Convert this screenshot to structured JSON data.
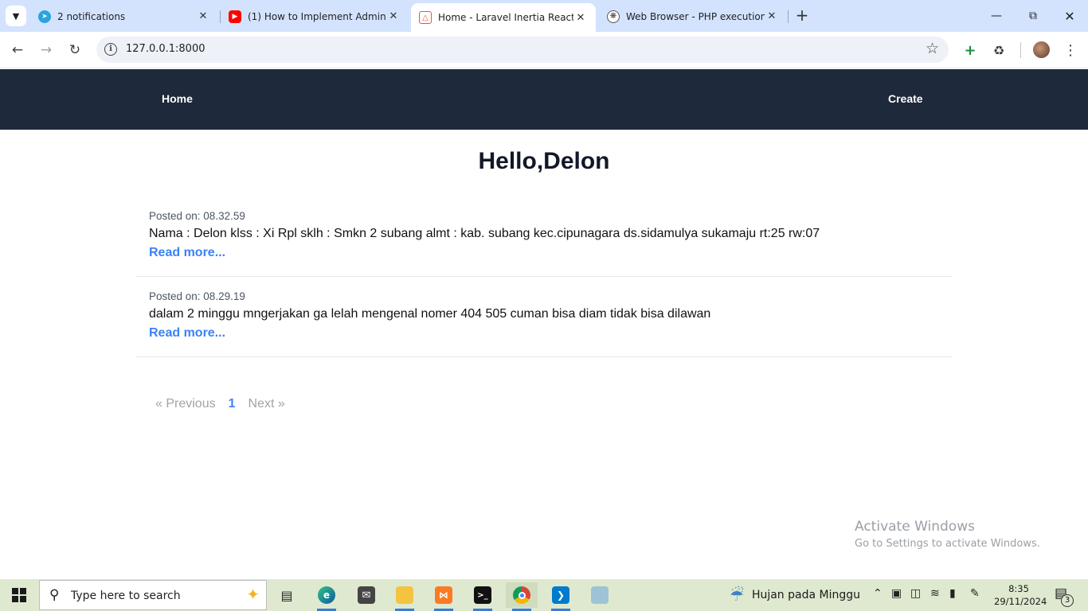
{
  "browser": {
    "tabs": [
      {
        "title": "2 notifications",
        "favicon": "telegram-icon"
      },
      {
        "title": "(1) How to Implement AdminLTE",
        "favicon": "youtube-icon"
      },
      {
        "title": "Home - Laravel Inertia React",
        "favicon": "laravel-icon",
        "active": true
      },
      {
        "title": "Web Browser - PHP execution t",
        "favicon": "openai-icon"
      }
    ],
    "new_tab": "+",
    "url": "127.0.0.1:8000"
  },
  "navbar": {
    "home": "Home",
    "create": "Create"
  },
  "page": {
    "greeting": "Hello,Delon",
    "posts": [
      {
        "posted_on": "Posted on: 08.32.59",
        "body": "Nama : Delon klss : Xi Rpl sklh : Smkn 2 subang almt : kab. subang kec.cipunagara ds.sidamulya sukamaju rt:25 rw:07",
        "read_more": "Read more..."
      },
      {
        "posted_on": "Posted on: 08.29.19",
        "body": "dalam 2 minggu mngerjakan ga lelah mengenal nomer 404 505 cuman bisa diam tidak bisa dilawan",
        "read_more": "Read more..."
      }
    ],
    "pagination": {
      "previous": "« Previous",
      "current": "1",
      "next": "Next »"
    }
  },
  "watermark": {
    "line1": "Activate Windows",
    "line2": "Go to Settings to activate Windows."
  },
  "taskbar": {
    "search_placeholder": "Type here to search",
    "weather": "Hujan pada Minggu",
    "time": "8:35",
    "date": "29/11/2024",
    "notification_count": "3"
  },
  "colors": {
    "navbar_bg": "#1e293b",
    "link": "#3b82f6",
    "tabstrip_bg": "#d3e3fd",
    "taskbar_bg": "#dfe9cf"
  }
}
